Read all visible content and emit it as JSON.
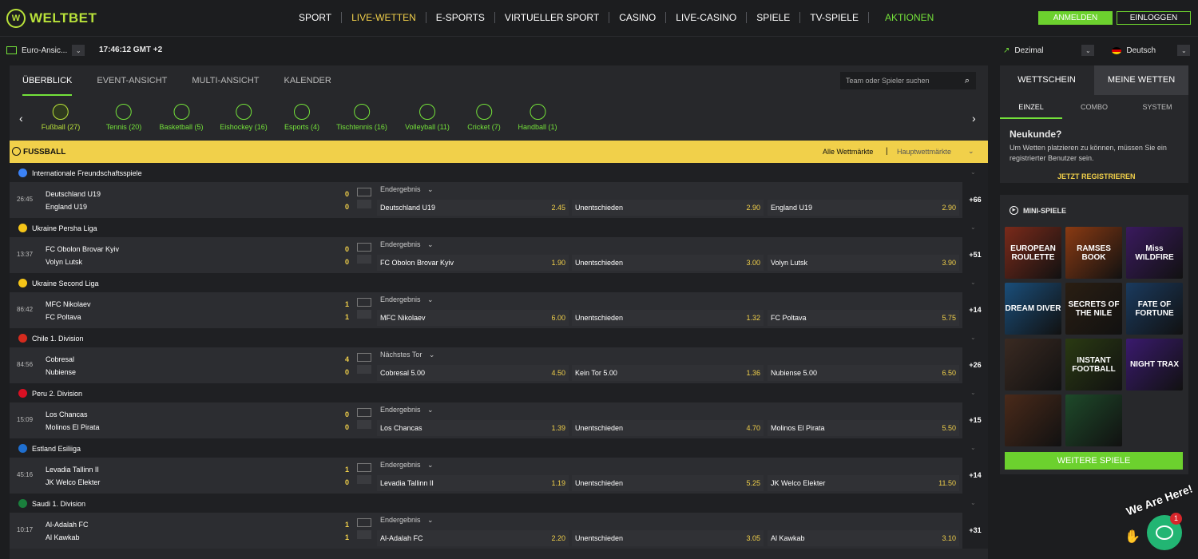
{
  "brand": {
    "logo_letters": "W",
    "name": "WELTBET"
  },
  "nav": [
    "SPORT",
    "LIVE-WETTEN",
    "E-SPORTS",
    "VIRTUELLER SPORT",
    "CASINO",
    "LIVE-CASINO",
    "SPIELE",
    "TV-SPIELE"
  ],
  "nav_promo": "AKTIONEN",
  "login_label": "ANMELDEN",
  "register_label": "EINLOGGEN",
  "view_select": "Euro-Ansic...",
  "clock": "17:46:12 GMT +2",
  "odds_format": "Dezimal",
  "language": "Deutsch",
  "tabs": [
    "ÜBERBLICK",
    "EVENT-ANSICHT",
    "MULTI-ANSICHT",
    "KALENDER"
  ],
  "search_placeholder": "Team oder Spieler suchen",
  "sports": [
    "Fußball (27)",
    "Tennis (20)",
    "Basketball (5)",
    "Eishockey (16)",
    "Esports (4)",
    "Tischtennis (16)",
    "Volleyball (11)",
    "Cricket (7)",
    "Handball (1)"
  ],
  "section_title": "FUSSBALL",
  "all_markets": "Alle Wettmärkte",
  "main_markets": "Hauptwettmärkte",
  "leagues": [
    {
      "name": "Internationale Freundschaftsspiele",
      "flag": "#3b82f6",
      "time": "26:45",
      "home": "Deutschland U19",
      "away": "England U19",
      "hs": "0",
      "as": "0",
      "market": "Endergebnis",
      "o1l": "Deutschland U19",
      "o1": "2.45",
      "oxl": "Unentschieden",
      "ox": "2.90",
      "o2l": "England U19",
      "o2": "2.90",
      "more": "+66"
    },
    {
      "name": "Ukraine Persha Liga",
      "flag": "#f5c518",
      "time": "13:37",
      "home": "FC Obolon Brovar Kyiv",
      "away": "Volyn Lutsk",
      "hs": "0",
      "as": "0",
      "market": "Endergebnis",
      "o1l": "FC Obolon Brovar Kyiv",
      "o1": "1.90",
      "oxl": "Unentschieden",
      "ox": "3.00",
      "o2l": "Volyn Lutsk",
      "o2": "3.90",
      "more": "+51"
    },
    {
      "name": "Ukraine Second Liga",
      "flag": "#f5c518",
      "time": "86:42",
      "home": "MFC Nikolaev",
      "away": "FC Poltava",
      "hs": "1",
      "as": "1",
      "market": "Endergebnis",
      "o1l": "MFC Nikolaev",
      "o1": "6.00",
      "oxl": "Unentschieden",
      "ox": "1.32",
      "o2l": "FC Poltava",
      "o2": "5.75",
      "more": "+14"
    },
    {
      "name": "Chile 1. Division",
      "flag": "#d52b1e",
      "time": "84:56",
      "home": "Cobresal",
      "away": "Nubiense",
      "hs": "4",
      "as": "0",
      "market": "Nächstes Tor",
      "o1l": "Cobresal  5.00",
      "o1": "4.50",
      "oxl": "Kein Tor  5.00",
      "ox": "1.36",
      "o2l": "Nubiense  5.00",
      "o2": "6.50",
      "more": "+26"
    },
    {
      "name": "Peru 2. Division",
      "flag": "#d91023",
      "time": "15:09",
      "home": "Los Chancas",
      "away": "Molinos El Pirata",
      "hs": "0",
      "as": "0",
      "market": "Endergebnis",
      "o1l": "Los Chancas",
      "o1": "1.39",
      "oxl": "Unentschieden",
      "ox": "4.70",
      "o2l": "Molinos El Pirata",
      "o2": "5.50",
      "more": "+15"
    },
    {
      "name": "Estland Esiliiga",
      "flag": "#1f6fd0",
      "time": "45:16",
      "home": "Levadia Tallinn II",
      "away": "JK Welco Elekter",
      "hs": "1",
      "as": "0",
      "market": "Endergebnis",
      "o1l": "Levadia Tallinn II",
      "o1": "1.19",
      "oxl": "Unentschieden",
      "ox": "5.25",
      "o2l": "JK Welco Elekter",
      "o2": "11.50",
      "more": "+14"
    },
    {
      "name": "Saudi 1. Division",
      "flag": "#1a7f3c",
      "time": "10:17",
      "home": "Al-Adalah FC",
      "away": "Al Kawkab",
      "hs": "1",
      "as": "1",
      "market": "Endergebnis",
      "o1l": "Al-Adalah FC",
      "o1": "2.20",
      "oxl": "Unentschieden",
      "ox": "3.05",
      "o2l": "Al Kawkab",
      "o2": "3.10",
      "more": "+31"
    }
  ],
  "betslip": {
    "tab1": "WETTSCHEIN",
    "tab2": "MEINE WETTEN",
    "sub": [
      "EINZEL",
      "COMBO",
      "SYSTEM"
    ],
    "title": "Neukunde?",
    "text": "Um Wetten platzieren zu können, müssen Sie ein registrierter Benutzer sein.",
    "cta": "JETZT REGISTRIEREN"
  },
  "mini_games": {
    "title": "MINI-SPIELE",
    "games": [
      "EUROPEAN ROULETTE",
      "RAMSES BOOK",
      "Miss WILDFIRE",
      "DREAM DIVER",
      "SECRETS OF THE NILE",
      "FATE OF FORTUNE",
      "",
      "INSTANT FOOTBALL",
      "NIGHT TRAX",
      "",
      ""
    ],
    "more": "WEITERE SPIELE"
  },
  "chat": {
    "label": "We Are Here!",
    "badge": "1"
  }
}
